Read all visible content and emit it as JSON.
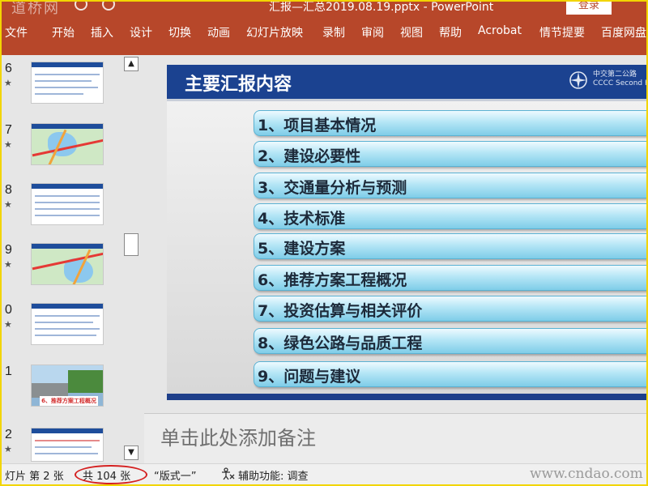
{
  "titlebar": {
    "watermark_logo": "道桥网",
    "document_title": "汇报—汇总2019.08.19.pptx  -  PowerPoint",
    "login_label": "登录"
  },
  "ribbon": {
    "tabs": [
      "文件",
      "开始",
      "插入",
      "设计",
      "切换",
      "动画",
      "幻灯片放映",
      "录制",
      "审阅",
      "视图",
      "帮助",
      "Acrobat",
      "情节提要",
      "百度网盘"
    ]
  },
  "thumbnails": [
    {
      "number": "6",
      "star": "★"
    },
    {
      "number": "7",
      "star": "★"
    },
    {
      "number": "8",
      "star": "★"
    },
    {
      "number": "9",
      "star": "★"
    },
    {
      "number": "0",
      "star": "★"
    },
    {
      "number": "1",
      "star": "",
      "caption": "6、推荐方案工程概况"
    },
    {
      "number": "2",
      "star": "★"
    }
  ],
  "scrollbar": {
    "up": "▲",
    "down": "▼"
  },
  "slide": {
    "title": "主要汇报内容",
    "company_name_line1": "中交第二公路",
    "company_name_line2": "CCCC Second H",
    "agenda": [
      "1、项目基本情况",
      "2、建设必要性",
      "3、交通量分析与预测",
      "4、技术标准",
      "5、建设方案",
      "6、推荐方案工程概况",
      "7、投资估算与相关评价",
      "8、绿色公路与品质工程",
      "9、问题与建议"
    ]
  },
  "notes": {
    "placeholder": "单击此处添加备注"
  },
  "statusbar": {
    "slide_indicator": "灯片 第 2 张",
    "slide_total": "共 104 张",
    "layout_name": "“版式一”",
    "accessibility": "辅助功能: 调查",
    "site_watermark": "www.cndao.com"
  },
  "colors": {
    "ribbon": "#b7472a",
    "slide_header": "#1b4290",
    "agenda_fill": "#7fcde8",
    "annotation_ring": "#d42020",
    "frame_border": "#f2d500"
  }
}
